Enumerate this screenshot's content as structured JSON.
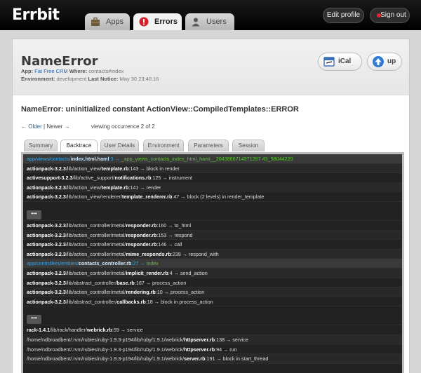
{
  "app": {
    "logo_main": "Errbit",
    "logo_tail": ""
  },
  "nav": {
    "tabs": [
      {
        "label": "Apps",
        "icon": "briefcase-icon"
      },
      {
        "label": "Errors",
        "icon": "error-icon"
      },
      {
        "label": "Users",
        "icon": "user-icon"
      }
    ],
    "edit_profile": "Edit profile",
    "sign_out": "Sign out"
  },
  "error": {
    "title": "NameError",
    "app_label": "App:",
    "app_name": "Fat Free CRM",
    "where_label": "Where:",
    "where": "contacts#index",
    "env_label": "Environment:",
    "env": "development",
    "last_notice_label": "Last Notice:",
    "last_notice": "May 30 23:40:16",
    "ical": "iCal",
    "up": "up",
    "message": "NameError: uninitialized constant ActionView::CompiledTemplates::ERROR"
  },
  "pager": {
    "older": "Older",
    "separator": "|",
    "newer": "Newer",
    "occurrence": "viewing occurrence 2 of 2",
    "left_arrow": "←",
    "right_arrow": "→"
  },
  "subtabs": [
    "Summary",
    "Backtrace",
    "User Details",
    "Environment",
    "Parameters",
    "Session"
  ],
  "backtrace": {
    "more_label": "•••",
    "blocks": [
      [
        {
          "app": true,
          "pre": "app/views/contacts/",
          "file": "index.html.haml",
          "post": ":3 → ",
          "method": "_app_views_contacts_index_html_haml__2043866714371267 43_58044220"
        },
        {
          "gem": "actionpack-3.2.3",
          "pre": "/lib/action_view/",
          "file": "template.rb",
          "post": ":143 → block in render"
        },
        {
          "gem": "activesupport-3.2.3",
          "pre": "/lib/active_support/",
          "file": "notifications.rb",
          "post": ":125 → instrument"
        },
        {
          "gem": "actionpack-3.2.3",
          "pre": "/lib/action_view/",
          "file": "template.rb",
          "post": ":141 → render"
        },
        {
          "gem": "actionpack-3.2.3",
          "pre": "/lib/action_view/renderer/",
          "file": "template_renderer.rb",
          "post": ":47 → block (2 levels) in render_template"
        }
      ],
      [
        {
          "gem": "actionpack-3.2.3",
          "pre": "/lib/action_controller/metal/",
          "file": "responder.rb",
          "post": ":160 → to_html"
        },
        {
          "gem": "actionpack-3.2.3",
          "pre": "/lib/action_controller/metal/",
          "file": "responder.rb",
          "post": ":153 → respond"
        },
        {
          "gem": "actionpack-3.2.3",
          "pre": "/lib/action_controller/metal/",
          "file": "responder.rb",
          "post": ":146 → call"
        },
        {
          "gem": "actionpack-3.2.3",
          "pre": "/lib/action_controller/metal/",
          "file": "mime_responds.rb",
          "post": ":239 → respond_with"
        },
        {
          "app": true,
          "pre": "app/controllers/entities/",
          "file": "contacts_controller.rb",
          "post": ":27 → ",
          "method": "index"
        },
        {
          "gem": "actionpack-3.2.3",
          "pre": "/lib/action_controller/metal/",
          "file": "implicit_render.rb",
          "post": ":4 → send_action"
        },
        {
          "gem": "actionpack-3.2.3",
          "pre": "/lib/abstract_controller/",
          "file": "base.rb",
          "post": ":167 → process_action"
        },
        {
          "gem": "actionpack-3.2.3",
          "pre": "/lib/action_controller/metal/",
          "file": "rendering.rb",
          "post": ":10 → process_action"
        },
        {
          "gem": "actionpack-3.2.3",
          "pre": "/lib/abstract_controller/",
          "file": "callbacks.rb",
          "post": ":18 → block in process_action"
        }
      ],
      [
        {
          "gem": "rack-1.4.1",
          "pre": "/lib/rack/handler/",
          "file": "webrick.rb",
          "post": ":59 → service"
        },
        {
          "gem": "",
          "pre": "/home/ndbroadbent/.rvm/rubies/ruby-1.9.3-p194/lib/ruby/1.9.1/webrick/",
          "file": "httpserver.rb",
          "post": ":138 → service"
        },
        {
          "gem": "",
          "pre": "/home/ndbroadbent/.rvm/rubies/ruby-1.9.3-p194/lib/ruby/1.9.1/webrick/",
          "file": "httpserver.rb",
          "post": ":94 → run"
        },
        {
          "gem": "",
          "pre": "/home/ndbroadbent/.rvm/rubies/ruby-1.9.3-p194/lib/ruby/1.9.1/webrick/",
          "file": "server.rb",
          "post": ":191 → block in start_thread"
        }
      ]
    ]
  },
  "colors": {
    "app_path": "#3aa6e6",
    "app_method": "#59c432",
    "sign_out_dot": "#e4242b",
    "link": "#1f62a6"
  }
}
